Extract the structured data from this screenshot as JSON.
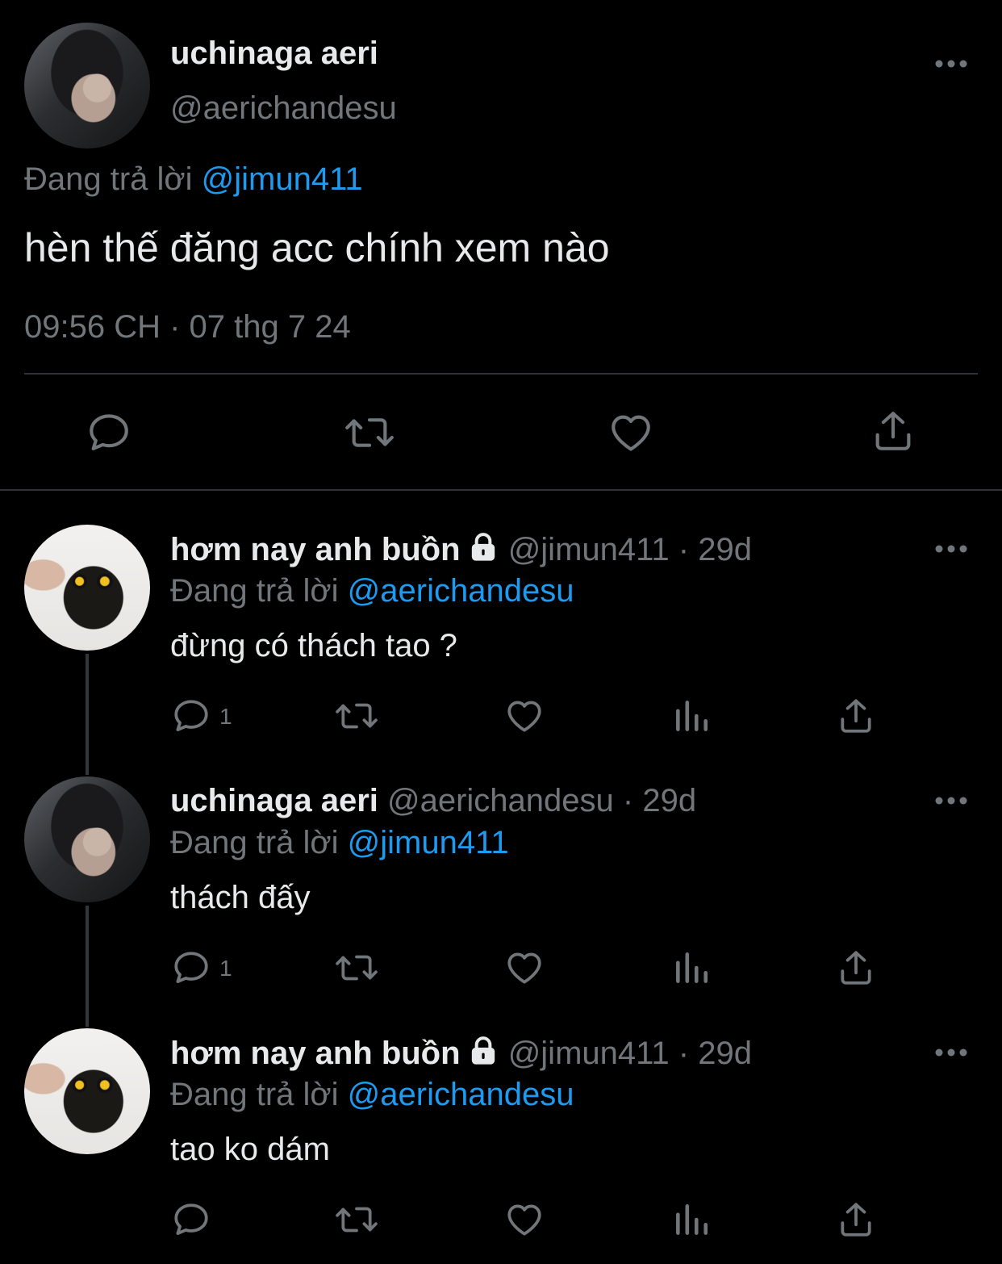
{
  "main_tweet": {
    "display_name": "uchinaga aeri",
    "handle": "@aerichandesu",
    "replying_prefix": "Đang trả lời",
    "replying_to": "@jimun411",
    "text": "hèn thế đăng acc chính xem nào",
    "timestamp": "09:56 CH · 07 thg 7 24",
    "actions": [
      "reply-icon",
      "retweet-icon",
      "like-icon",
      "share-icon"
    ]
  },
  "replies": [
    {
      "display_name": "hơm nay anh buồn",
      "locked": true,
      "handle": "@jimun411",
      "separator": "·",
      "age": "29d",
      "replying_prefix": "Đang trả lời",
      "replying_to": "@aerichandesu",
      "text": "đừng có thách tao ?",
      "reply_count": "1"
    },
    {
      "display_name": "uchinaga aeri",
      "locked": false,
      "handle": "@aerichandesu",
      "separator": "·",
      "age": "29d",
      "replying_prefix": "Đang trả lời",
      "replying_to": "@jimun411",
      "text": "thách đấy",
      "reply_count": "1"
    },
    {
      "display_name": "hơm nay anh buồn",
      "locked": true,
      "handle": "@jimun411",
      "separator": "·",
      "age": "29d",
      "replying_prefix": "Đang trả lời",
      "replying_to": "@aerichandesu",
      "text": "tao ko dám",
      "reply_count": ""
    }
  ],
  "colors": {
    "background": "#000000",
    "text": "#e7e9ea",
    "muted": "#71767b",
    "link": "#1d9bf0",
    "divider": "#2f3336"
  }
}
